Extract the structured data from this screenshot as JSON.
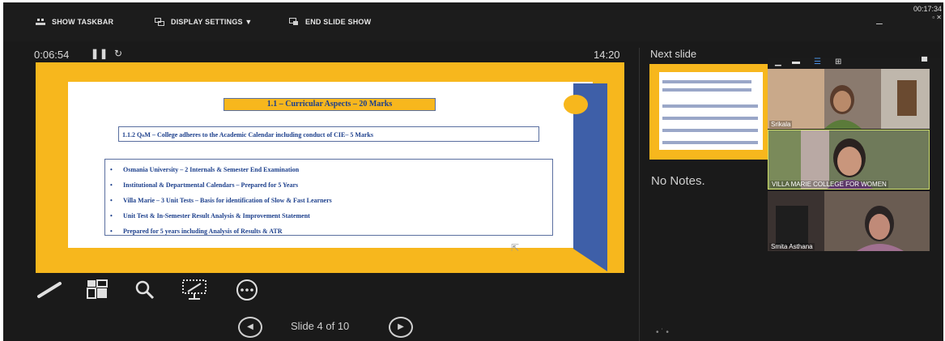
{
  "topbar": {
    "show_taskbar": "SHOW TASKBAR",
    "display_settings": "DISPLAY SETTINGS ▼",
    "end_slide_show": "END SLIDE SHOW",
    "minimize": "–",
    "clock_time": "00:17:34"
  },
  "presenter": {
    "elapsed": "0:06:54",
    "pause_icon": "pause-icon",
    "restart_icon": "restart-icon",
    "current_time": "14:20",
    "slide_counter": "Slide 4 of 10"
  },
  "slide": {
    "title": "1.1 – Curricular Aspects – 20 Marks",
    "subtitle": "1.1.2 QₙM – College adheres to  the Academic Calendar including conduct of CIE– 5 Marks",
    "bullets": [
      "Osmania University – 2 Internals & Semester End Examination",
      "Institutional  & Departmental Calendars – Prepared for 5 Years",
      "Villa Marie – 3 Unit Tests – Basis for identification of Slow & Fast Learners",
      "Unit Test & In-Semester Result Analysis & Improvement Statement",
      "Prepared for 5 years including Analysis of Results & ATR"
    ]
  },
  "next": {
    "label": "Next slide",
    "notes": "No Notes."
  },
  "video": {
    "participants": [
      {
        "name": "Srikala"
      },
      {
        "name": "VILLA MARIE COLLEGE FOR WOMEN"
      },
      {
        "name": "Smita Asthana"
      }
    ]
  },
  "colors": {
    "accent_yellow": "#f7b71d",
    "ribbon_blue": "#3e5fa8",
    "text_blue": "#1c3f8c",
    "background": "#1a1a1a"
  }
}
